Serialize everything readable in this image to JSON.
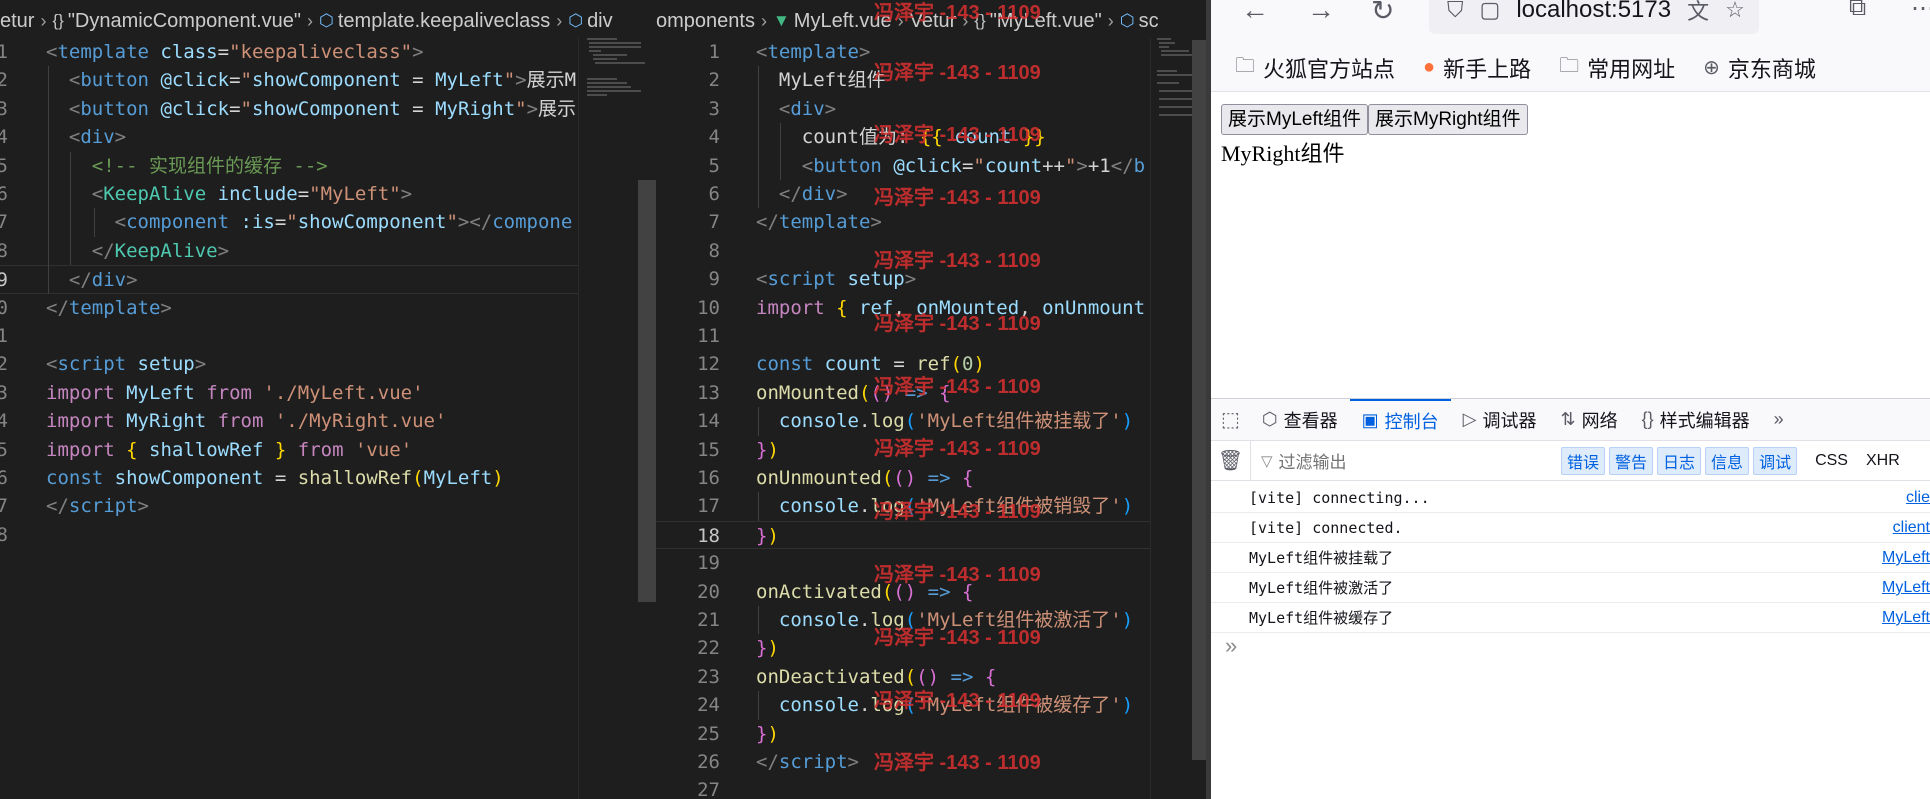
{
  "editor_left": {
    "breadcrumbs": [
      {
        "label": "etur",
        "icon": ""
      },
      {
        "label": "\"DynamicComponent.vue\"",
        "icon": "braces-icon"
      },
      {
        "label": "template.keepaliveclass",
        "icon": "cube-icon"
      },
      {
        "label": "div",
        "icon": "cube-icon"
      }
    ],
    "active_line": "9",
    "lines": [
      {
        "n": "1",
        "html": "<span class=\"punct\">&lt;</span><span class=\"tag\">template</span> <span class=\"attr\">class</span><span class=\"txt\">=</span><span class=\"str\">\"keepaliveclass\"</span><span class=\"punct\">&gt;</span>"
      },
      {
        "n": "2",
        "html": "  <span class=\"punct\">&lt;</span><span class=\"tag\">button</span> <span class=\"attr\">@click</span><span class=\"txt\">=</span><span class=\"str\">\"</span><span class=\"var\">showComponent</span> <span class=\"txt\">=</span> <span class=\"var\">MyLeft</span><span class=\"str\">\"</span><span class=\"punct\">&gt;</span><span class=\"txt\">展示M</span>"
      },
      {
        "n": "3",
        "html": "  <span class=\"punct\">&lt;</span><span class=\"tag\">button</span> <span class=\"attr\">@click</span><span class=\"txt\">=</span><span class=\"str\">\"</span><span class=\"var\">showComponent</span> <span class=\"txt\">=</span> <span class=\"var\">MyRight</span><span class=\"str\">\"</span><span class=\"punct\">&gt;</span><span class=\"txt\">展示</span>"
      },
      {
        "n": "4",
        "html": "  <span class=\"punct\">&lt;</span><span class=\"tag\">div</span><span class=\"punct\">&gt;</span>"
      },
      {
        "n": "5",
        "html": "    <span class=\"cmt\">&lt;!-- 实现组件的缓存 --&gt;</span>"
      },
      {
        "n": "6",
        "html": "    <span class=\"punct\">&lt;</span><span class=\"tag\" style=\"color:#4ec9b0\">KeepAlive</span> <span class=\"attr\">include</span><span class=\"txt\">=</span><span class=\"str\">\"MyLeft\"</span><span class=\"punct\">&gt;</span>"
      },
      {
        "n": "7",
        "html": "      <span class=\"punct\">&lt;</span><span class=\"tag\">component</span> <span class=\"attr\">:is</span><span class=\"txt\">=</span><span class=\"str\">\"</span><span class=\"var\">showComponent</span><span class=\"str\">\"</span><span class=\"punct\">&gt;&lt;/</span><span class=\"tag\">compone</span>"
      },
      {
        "n": "8",
        "html": "    <span class=\"punct\">&lt;/</span><span class=\"tag\" style=\"color:#4ec9b0\">KeepAlive</span><span class=\"punct\">&gt;</span>"
      },
      {
        "n": "9",
        "html": "  <span class=\"punct\">&lt;/</span><span class=\"tag\">div</span><span class=\"punct\">&gt;</span>"
      },
      {
        "n": "0",
        "html": "<span class=\"punct\">&lt;/</span><span class=\"tag\">template</span><span class=\"punct\">&gt;</span>"
      },
      {
        "n": "1",
        "html": ""
      },
      {
        "n": "2",
        "html": "<span class=\"punct\">&lt;</span><span class=\"tag\">script</span> <span class=\"attr\">setup</span><span class=\"punct\">&gt;</span>"
      },
      {
        "n": "3",
        "html": "<span class=\"kw\">import</span> <span class=\"var\">MyLeft</span> <span class=\"kw\">from</span> <span class=\"str\">'./MyLeft.vue'</span>"
      },
      {
        "n": "4",
        "html": "<span class=\"kw\">import</span> <span class=\"var\">MyRight</span> <span class=\"kw\">from</span> <span class=\"str\">'./MyRight.vue'</span>"
      },
      {
        "n": "5",
        "html": "<span class=\"kw\">import</span> <span class=\"br1\">{</span> <span class=\"var\">shallowRef</span> <span class=\"br1\">}</span> <span class=\"kw\">from</span> <span class=\"str\">'vue'</span>"
      },
      {
        "n": "6",
        "html": "<span class=\"kwb\">const</span> <span class=\"var\">showComponent</span> <span class=\"txt\">=</span> <span class=\"fn\">shallowRef</span><span class=\"br1\">(</span><span class=\"var\">MyLeft</span><span class=\"br1\">)</span>"
      },
      {
        "n": "7",
        "html": "<span class=\"punct\">&lt;/</span><span class=\"tag\">script</span><span class=\"punct\">&gt;</span>"
      },
      {
        "n": "8",
        "html": ""
      }
    ]
  },
  "editor_right": {
    "breadcrumbs": [
      {
        "label": "omponents",
        "icon": ""
      },
      {
        "label": "MyLeft.vue",
        "icon": "vue-icon"
      },
      {
        "label": "Vetur",
        "icon": ""
      },
      {
        "label": "\"MyLeft.vue\"",
        "icon": "braces-icon"
      },
      {
        "label": "sc",
        "icon": "cube-icon"
      }
    ],
    "active_line": "18",
    "lines": [
      {
        "n": "1",
        "html": "<span class=\"punct\">&lt;</span><span class=\"tag\">template</span><span class=\"punct\">&gt;</span>"
      },
      {
        "n": "2",
        "html": "  <span class=\"txt\">MyLeft组件</span>"
      },
      {
        "n": "3",
        "html": "  <span class=\"punct\">&lt;</span><span class=\"tag\">div</span><span class=\"punct\">&gt;</span>"
      },
      {
        "n": "4",
        "html": "    <span class=\"txt\">count值为: </span><span class=\"br1\">{{</span> <span class=\"var\">count</span> <span class=\"br1\">}}</span>"
      },
      {
        "n": "5",
        "html": "    <span class=\"punct\">&lt;</span><span class=\"tag\">button</span> <span class=\"attr\">@click</span><span class=\"txt\">=</span><span class=\"str\">\"</span><span class=\"var\">count</span><span class=\"txt\">++</span><span class=\"str\">\"</span><span class=\"punct\">&gt;</span><span class=\"txt\">+1</span><span class=\"punct\">&lt;/</span><span class=\"tag\">b</span>"
      },
      {
        "n": "6",
        "html": "  <span class=\"punct\">&lt;/</span><span class=\"tag\">div</span><span class=\"punct\">&gt;</span>"
      },
      {
        "n": "7",
        "html": "<span class=\"punct\">&lt;/</span><span class=\"tag\">template</span><span class=\"punct\">&gt;</span>"
      },
      {
        "n": "8",
        "html": ""
      },
      {
        "n": "9",
        "html": "<span class=\"punct\">&lt;</span><span class=\"tag\">script</span> <span class=\"attr\">setup</span><span class=\"punct\">&gt;</span>"
      },
      {
        "n": "10",
        "html": "<span class=\"kw\">import</span> <span class=\"br1\">{</span> <span class=\"var\">ref</span><span class=\"txt\">,</span> <span class=\"var\">onMounted</span><span class=\"txt\">,</span> <span class=\"var\">onUnmount</span>"
      },
      {
        "n": "11",
        "html": ""
      },
      {
        "n": "12",
        "html": "<span class=\"kwb\">const</span> <span class=\"var\">count</span> <span class=\"txt\">=</span> <span class=\"fn\">ref</span><span class=\"br1\">(</span><span class=\"num\">0</span><span class=\"br1\">)</span>"
      },
      {
        "n": "13",
        "html": "<span class=\"fn\">onMounted</span><span class=\"br1\">(</span><span class=\"br2\">()</span> <span class=\"kwb\">=&gt;</span> <span class=\"br2\">{</span>"
      },
      {
        "n": "14",
        "html": "  <span class=\"var\">console</span><span class=\"txt\">.</span><span class=\"fn\">log</span><span class=\"br3\">(</span><span class=\"str\">'MyLeft组件被挂载了'</span><span class=\"br3\">)</span>"
      },
      {
        "n": "15",
        "html": "<span class=\"br2\">}</span><span class=\"br1\">)</span>"
      },
      {
        "n": "16",
        "html": "<span class=\"fn\">onUnmounted</span><span class=\"br1\">(</span><span class=\"br2\">()</span> <span class=\"kwb\">=&gt;</span> <span class=\"br2\">{</span>"
      },
      {
        "n": "17",
        "html": "  <span class=\"var\">console</span><span class=\"txt\">.</span><span class=\"fn\">log</span><span class=\"br3\">(</span><span class=\"str\">'MyLeft组件被销毁了'</span><span class=\"br3\">)</span>"
      },
      {
        "n": "18",
        "html": "<span class=\"br2\">}</span><span class=\"br1\">)</span>"
      },
      {
        "n": "19",
        "html": ""
      },
      {
        "n": "20",
        "html": "<span class=\"fn\">onActivated</span><span class=\"br1\">(</span><span class=\"br2\">()</span> <span class=\"kwb\">=&gt;</span> <span class=\"br2\">{</span>"
      },
      {
        "n": "21",
        "html": "  <span class=\"var\">console</span><span class=\"txt\">.</span><span class=\"fn\">log</span><span class=\"br3\">(</span><span class=\"str\">'MyLeft组件被激活了'</span><span class=\"br3\">)</span>"
      },
      {
        "n": "22",
        "html": "<span class=\"br2\">}</span><span class=\"br1\">)</span>"
      },
      {
        "n": "23",
        "html": "<span class=\"fn\">onDeactivated</span><span class=\"br1\">(</span><span class=\"br2\">()</span> <span class=\"kwb\">=&gt;</span> <span class=\"br2\">{</span>"
      },
      {
        "n": "24",
        "html": "  <span class=\"var\">console</span><span class=\"txt\">.</span><span class=\"fn\">log</span><span class=\"br3\">(</span><span class=\"str\">'MyLeft组件被缓存了'</span><span class=\"br3\">)</span>"
      },
      {
        "n": "25",
        "html": "<span class=\"br2\">}</span><span class=\"br1\">)</span>"
      },
      {
        "n": "26",
        "html": "<span class=\"punct\">&lt;/</span><span class=\"tag\">script</span><span class=\"punct\">&gt;</span>"
      },
      {
        "n": "27",
        "html": ""
      }
    ]
  },
  "watermark": {
    "text": "冯泽宇 -143 - 1109",
    "color": "#d93030"
  },
  "browser": {
    "url": "localhost:5173",
    "bookmarks": [
      "火狐官方站点",
      "新手上路",
      "常用网址",
      "京东商城"
    ],
    "page": {
      "button_left": "展示MyLeft组件",
      "button_right": "展示MyRight组件",
      "content": "MyRight组件"
    },
    "devtools": {
      "tabs": [
        "查看器",
        "控制台",
        "调试器",
        "网络",
        "样式编辑器"
      ],
      "selected_tab": "控制台",
      "filter_placeholder": "过滤输出",
      "levels": [
        "错误",
        "警告",
        "日志",
        "信息",
        "调试"
      ],
      "extra_filters": [
        "CSS",
        "XHR"
      ],
      "messages": [
        {
          "text": "[vite] connecting...",
          "source": "clie"
        },
        {
          "text": "[vite] connected.",
          "source": "client"
        },
        {
          "text": "MyLeft组件被挂载了",
          "source": "MyLeft"
        },
        {
          "text": "MyLeft组件被激活了",
          "source": "MyLeft"
        },
        {
          "text": "MyLeft组件被缓存了",
          "source": "MyLeft"
        }
      ],
      "prompt": "»"
    }
  }
}
